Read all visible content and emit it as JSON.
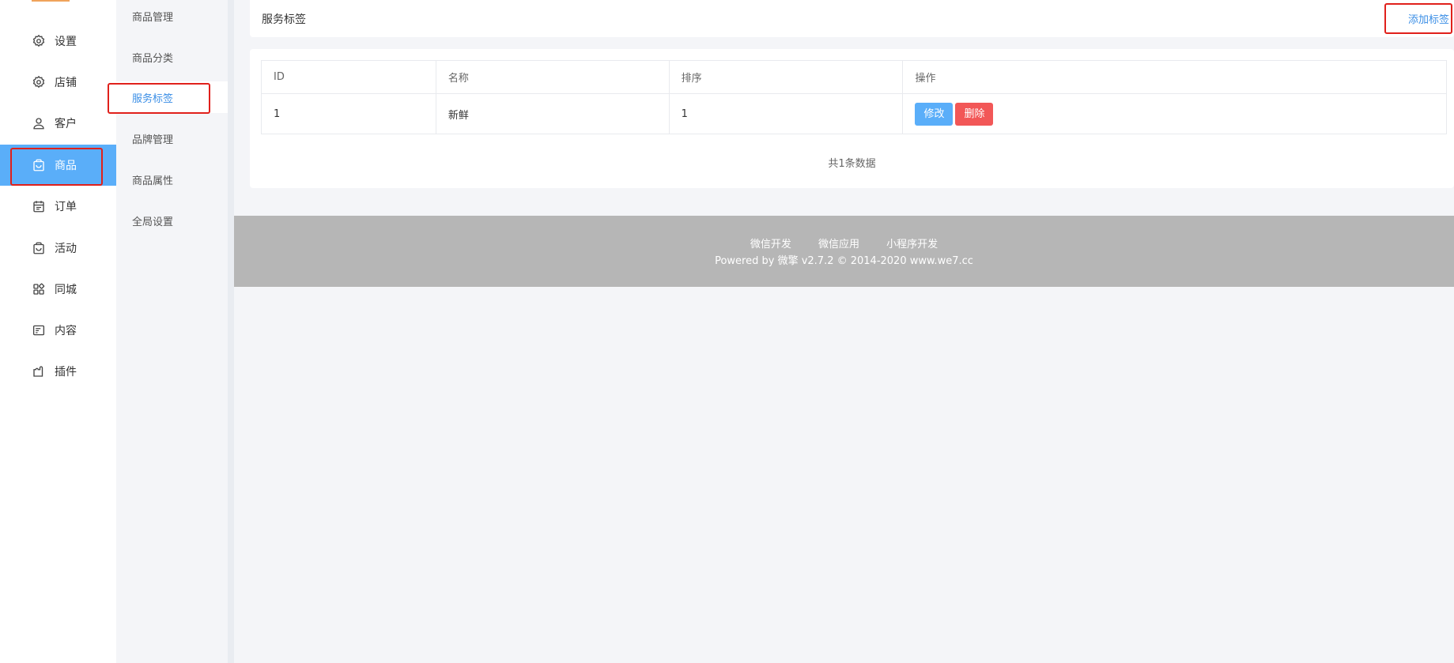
{
  "nav_primary": {
    "items": [
      {
        "label": "设置",
        "icon": "gear-icon"
      },
      {
        "label": "店铺",
        "icon": "gear-icon"
      },
      {
        "label": "客户",
        "icon": "user-icon"
      },
      {
        "label": "商品",
        "icon": "bag-icon",
        "active": true
      },
      {
        "label": "订单",
        "icon": "calendar-icon"
      },
      {
        "label": "活动",
        "icon": "bag-icon"
      },
      {
        "label": "同城",
        "icon": "grid-icon"
      },
      {
        "label": "内容",
        "icon": "list-icon"
      },
      {
        "label": "插件",
        "icon": "puzzle-icon"
      }
    ]
  },
  "nav_secondary": {
    "items": [
      {
        "label": "商品管理"
      },
      {
        "label": "商品分类"
      },
      {
        "label": "服务标签",
        "active": true
      },
      {
        "label": "品牌管理"
      },
      {
        "label": "商品属性"
      },
      {
        "label": "全局设置"
      }
    ]
  },
  "header": {
    "title": "服务标签",
    "add_label": "添加标签"
  },
  "table": {
    "columns": [
      "ID",
      "名称",
      "排序",
      "操作"
    ],
    "rows": [
      {
        "id": "1",
        "name": "新鲜",
        "sort": "1",
        "edit_label": "修改",
        "delete_label": "删除"
      }
    ],
    "count_text": "共1条数据"
  },
  "footer": {
    "links": [
      "微信开发",
      "微信应用",
      "小程序开发"
    ],
    "copyright": "Powered by 微擎 v2.7.2 © 2014-2020 www.we7.cc"
  },
  "colors": {
    "accent": "#5aaef9",
    "link": "#3a8ee6",
    "danger": "#f25757",
    "highlight": "#e0201b"
  }
}
